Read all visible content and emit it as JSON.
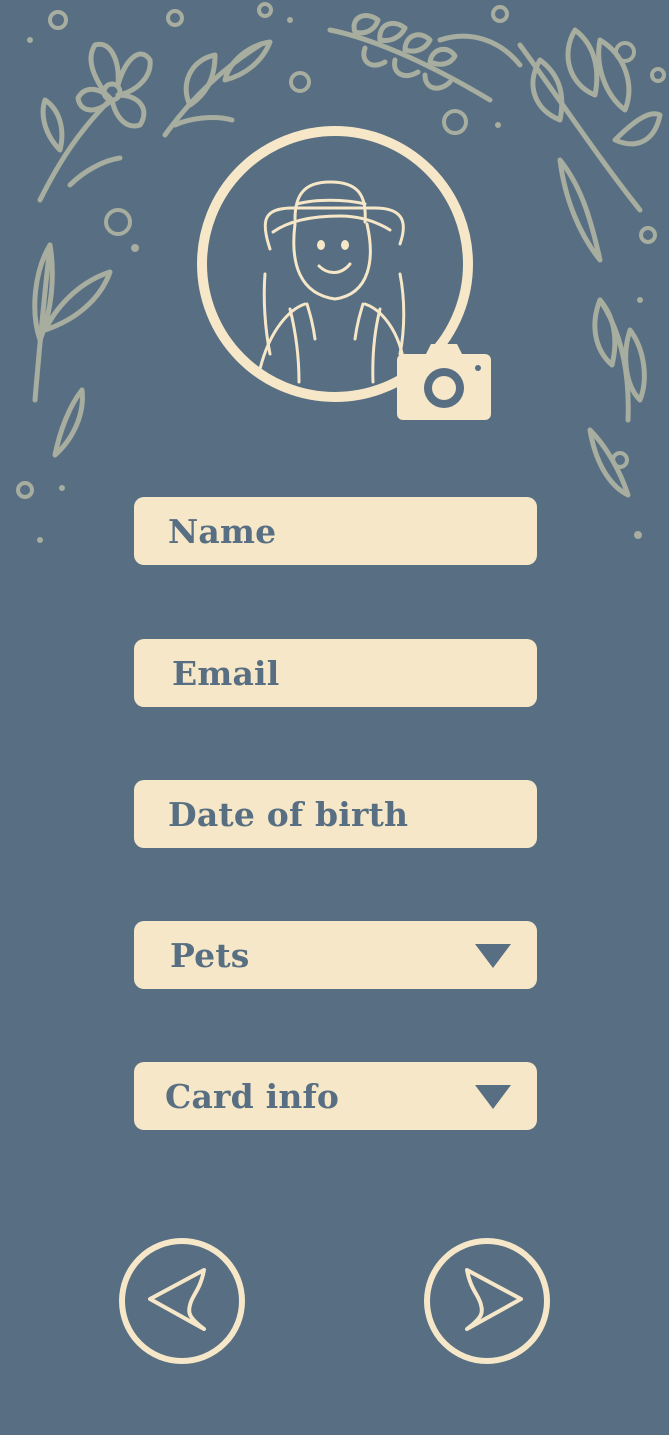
{
  "form": {
    "name_placeholder": "Name",
    "email_placeholder": "Email",
    "dob_placeholder": "Date of birth",
    "pets_label": "Pets",
    "card_label": "Card info"
  },
  "icons": {
    "avatar": "traveler-avatar-icon",
    "camera": "camera-icon",
    "back": "back-arrow-icon",
    "next": "next-arrow-icon",
    "dropdown": "chevron-down-icon"
  },
  "colors": {
    "background": "#586e82",
    "field": "#f5e7c8",
    "text": "#586e82",
    "decor": "#a7ad9f"
  }
}
